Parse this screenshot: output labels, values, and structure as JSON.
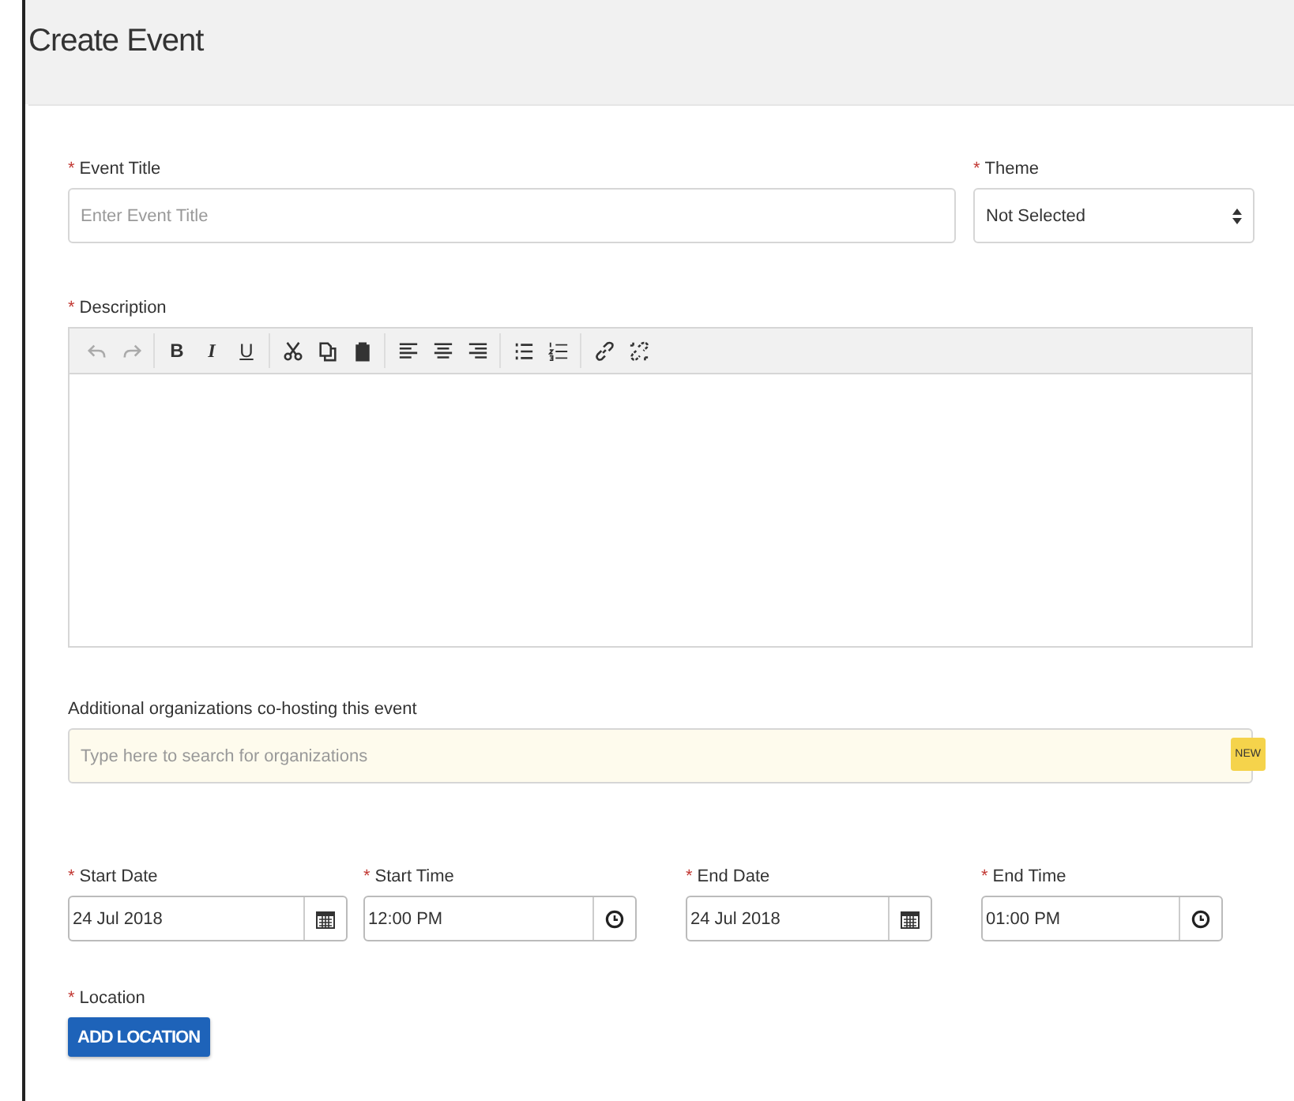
{
  "page_title": "Create Event",
  "event_title": {
    "label": "Event Title",
    "marker": "*",
    "placeholder": "Enter Event Title"
  },
  "theme": {
    "label": "Theme",
    "marker": "*",
    "value": "Not Selected"
  },
  "description": {
    "label": "Description",
    "marker": "*",
    "toolbar": [
      [
        {
          "kind": "undo",
          "disabled": true
        },
        {
          "kind": "redo",
          "disabled": true
        }
      ],
      [
        {
          "kind": "bold",
          "text": "B",
          "disabled": false
        },
        {
          "kind": "italic",
          "text": "I",
          "disabled": false
        },
        {
          "kind": "underline",
          "text": "U",
          "disabled": false
        }
      ],
      [
        {
          "kind": "cut",
          "disabled": false
        },
        {
          "kind": "copy",
          "disabled": false
        },
        {
          "kind": "paste",
          "disabled": false
        }
      ],
      [
        {
          "kind": "align-left",
          "disabled": false
        },
        {
          "kind": "align-center",
          "disabled": false
        },
        {
          "kind": "align-right",
          "disabled": false
        }
      ],
      [
        {
          "kind": "bullet-list",
          "disabled": false
        },
        {
          "kind": "numbered-list",
          "disabled": false
        }
      ],
      [
        {
          "kind": "link",
          "disabled": false
        },
        {
          "kind": "unlink",
          "disabled": false
        }
      ]
    ]
  },
  "organizations": {
    "label": "Additional organizations co-hosting this event",
    "placeholder": "Type here to search for organizations",
    "badge": "NEW"
  },
  "schedule": [
    {
      "kind": "date",
      "label": "Start Date",
      "marker": "*",
      "value": "24 Jul 2018"
    },
    {
      "kind": "time",
      "label": "Start Time",
      "marker": "*",
      "value": "12:00 PM"
    },
    {
      "kind": "date",
      "label": "End Date",
      "marker": "*",
      "value": "24 Jul 2018"
    },
    {
      "kind": "time",
      "label": "End Time",
      "marker": "*",
      "value": "01:00 PM"
    }
  ],
  "location": {
    "label": "Location",
    "marker": "*",
    "button": "ADD LOCATION"
  }
}
